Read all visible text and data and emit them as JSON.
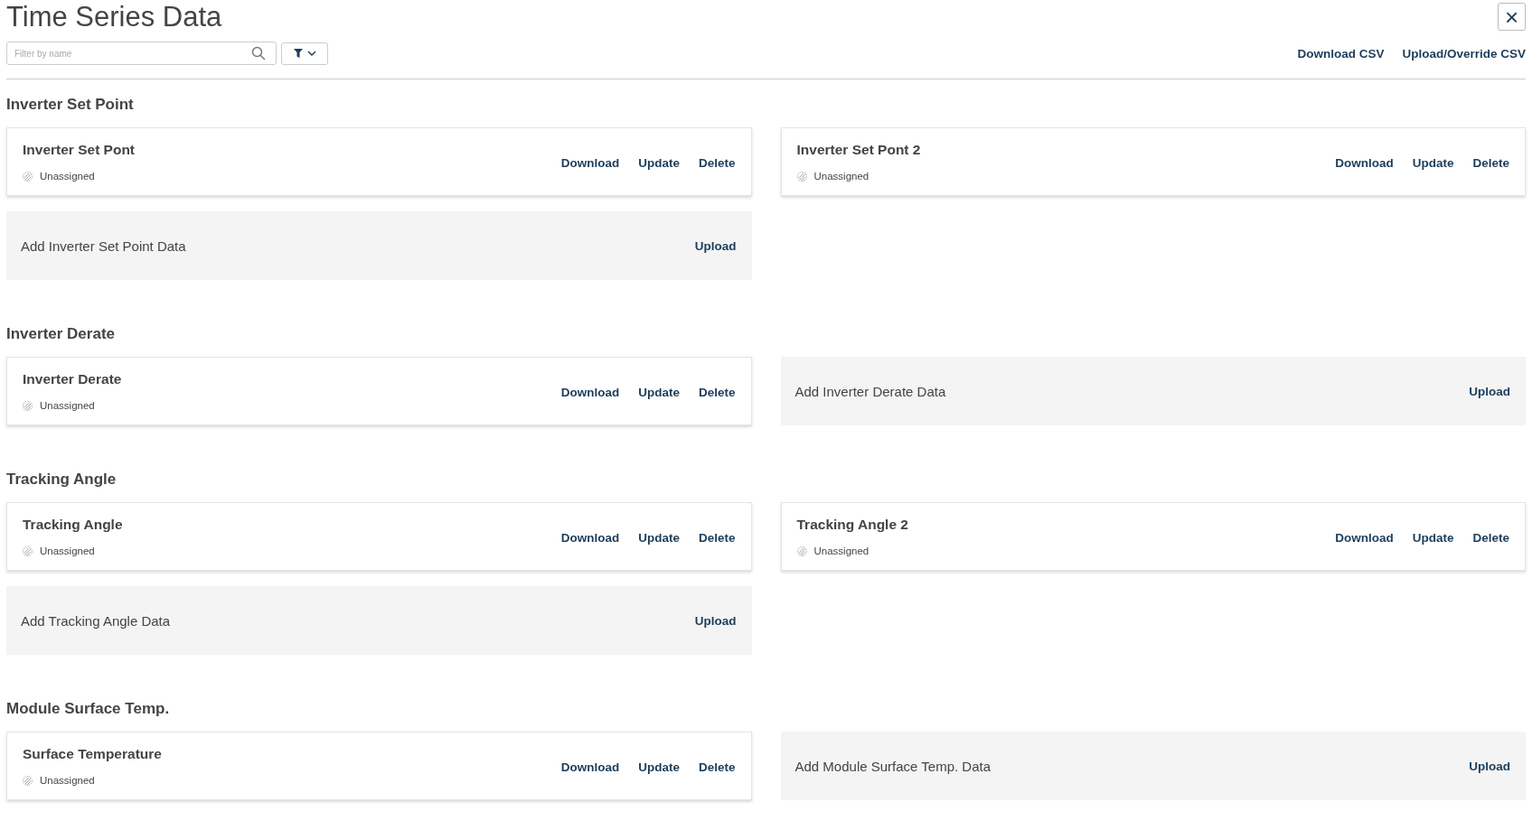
{
  "header": {
    "title": "Time Series Data",
    "close": "×"
  },
  "filter": {
    "placeholder": "Filter by name"
  },
  "actions": [
    "Download CSV",
    "Upload/Override CSV"
  ],
  "sections": [
    {
      "title": "Inverter Set Point",
      "items": [
        {
          "kind": "series",
          "name": "Inverter Set Pont",
          "status": "Unassigned",
          "actions": [
            "Download",
            "Update",
            "Delete"
          ]
        },
        {
          "kind": "series",
          "name": "Inverter Set Pont 2",
          "status": "Unassigned",
          "actions": [
            "Download",
            "Update",
            "Delete"
          ]
        },
        {
          "kind": "add",
          "label": "Add Inverter Set Point Data",
          "action": "Upload"
        }
      ]
    },
    {
      "title": "Inverter Derate",
      "items": [
        {
          "kind": "series",
          "name": "Inverter Derate",
          "status": "Unassigned",
          "actions": [
            "Download",
            "Update",
            "Delete"
          ]
        },
        {
          "kind": "add",
          "label": "Add Inverter Derate Data",
          "action": "Upload"
        }
      ]
    },
    {
      "title": "Tracking Angle",
      "items": [
        {
          "kind": "series",
          "name": "Tracking Angle",
          "status": "Unassigned",
          "actions": [
            "Download",
            "Update",
            "Delete"
          ]
        },
        {
          "kind": "series",
          "name": "Tracking Angle 2",
          "status": "Unassigned",
          "actions": [
            "Download",
            "Update",
            "Delete"
          ]
        },
        {
          "kind": "add",
          "label": "Add Tracking Angle Data",
          "action": "Upload"
        }
      ]
    },
    {
      "title": "Module Surface Temp.",
      "items": [
        {
          "kind": "series",
          "name": "Surface Temperature",
          "status": "Unassigned",
          "actions": [
            "Download",
            "Update",
            "Delete"
          ]
        },
        {
          "kind": "add",
          "label": "Add Module Surface Temp. Data",
          "action": "Upload"
        }
      ]
    }
  ]
}
